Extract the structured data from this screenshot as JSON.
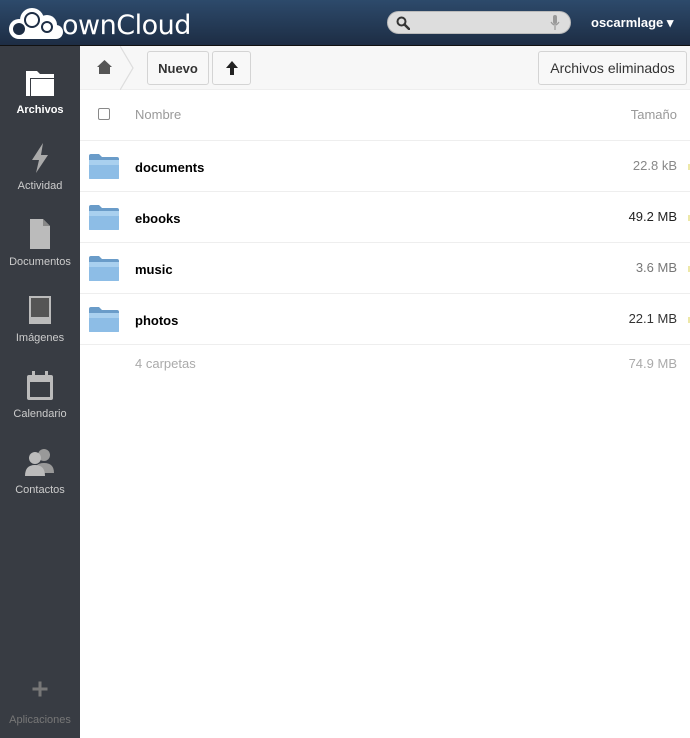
{
  "header": {
    "logo_text": "ownCloud",
    "search": {
      "value": "",
      "placeholder": ""
    },
    "user": "oscarmlage ▾"
  },
  "sidebar": {
    "items": [
      {
        "label": "Archivos",
        "icon": "folder-icon",
        "active": true
      },
      {
        "label": "Actividad",
        "icon": "lightning-icon"
      },
      {
        "label": "Documentos",
        "icon": "document-icon"
      },
      {
        "label": "Imágenes",
        "icon": "image-icon"
      },
      {
        "label": "Calendario",
        "icon": "calendar-icon"
      },
      {
        "label": "Contactos",
        "icon": "contacts-icon"
      }
    ],
    "apps_label": "Aplicaciones"
  },
  "controls": {
    "new_label": "Nuevo",
    "upload_icon": "upload-arrow-icon",
    "trash_label": "Archivos eliminados"
  },
  "table": {
    "col_name": "Nombre",
    "col_size": "Tamaño",
    "rows": [
      {
        "name": "documents",
        "size": "22.8 kB",
        "size_color": "#888888"
      },
      {
        "name": "ebooks",
        "size": "49.2 MB",
        "size_color": "#222222"
      },
      {
        "name": "music",
        "size": "3.6 MB",
        "size_color": "#777777"
      },
      {
        "name": "photos",
        "size": "22.1 MB",
        "size_color": "#333333"
      }
    ],
    "summary_label": "4 carpetas",
    "summary_size": "74.9 MB"
  },
  "colors": {
    "header": "#1d2d44",
    "sidebar": "#383c43",
    "folder": "#7fb2dc"
  }
}
